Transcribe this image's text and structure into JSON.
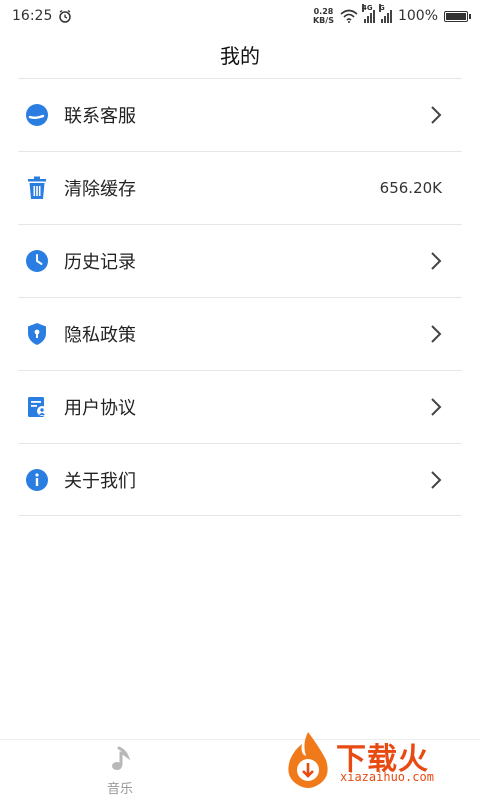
{
  "status_bar": {
    "time": "16:25",
    "net_speed_value": "0.28",
    "net_speed_unit": "KB/S",
    "sim1_tag": "4G",
    "sim2_tag": "G",
    "battery_percent": "100%",
    "battery_level": 1.0
  },
  "header": {
    "title": "我的"
  },
  "menu": {
    "items": [
      {
        "label": "联系客服",
        "icon": "customer-service-icon"
      },
      {
        "label": "清除缓存",
        "icon": "trash-icon",
        "value": "656.20K"
      },
      {
        "label": "历史记录",
        "icon": "clock-icon"
      },
      {
        "label": "隐私政策",
        "icon": "shield-icon"
      },
      {
        "label": "用户协议",
        "icon": "document-user-icon"
      },
      {
        "label": "关于我们",
        "icon": "info-icon"
      }
    ]
  },
  "tabbar": {
    "music_label": "音乐"
  },
  "watermark": {
    "brand": "下载火",
    "domain": "xiazaihuo.com"
  },
  "colors": {
    "accent": "#2a7de1",
    "chevron": "#444444",
    "tab_inactive": "#9a9a9a",
    "watermark": "#e84a12"
  }
}
